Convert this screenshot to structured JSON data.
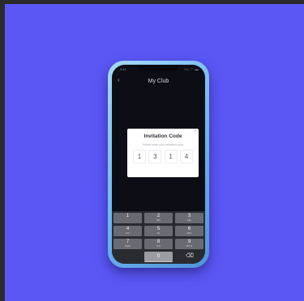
{
  "header": {
    "time": "9:41",
    "status_icons": "▪▪▪ ◠ ▬",
    "back_icon": "‹",
    "title": "My Club"
  },
  "modal": {
    "title": "Invitation Code",
    "hint": "Please enter club invitation code",
    "close_icon": "×",
    "code": [
      "1",
      "3",
      "1",
      "4"
    ]
  },
  "keypad": {
    "keys": [
      {
        "num": "1",
        "letters": ""
      },
      {
        "num": "2",
        "letters": "ABC"
      },
      {
        "num": "3",
        "letters": "DEF"
      },
      {
        "num": "4",
        "letters": "GHI"
      },
      {
        "num": "5",
        "letters": "JKL"
      },
      {
        "num": "6",
        "letters": "MNO"
      },
      {
        "num": "7",
        "letters": "PQRS"
      },
      {
        "num": "8",
        "letters": "TUV"
      },
      {
        "num": "9",
        "letters": "WXYZ"
      },
      {
        "num": "0",
        "letters": ""
      }
    ],
    "delete_icon": "⌫"
  },
  "colors": {
    "background": "#5b57f5",
    "phone_frame": "#6ab5ee",
    "screen": "#0d0e15",
    "modal": "#ffffff"
  }
}
